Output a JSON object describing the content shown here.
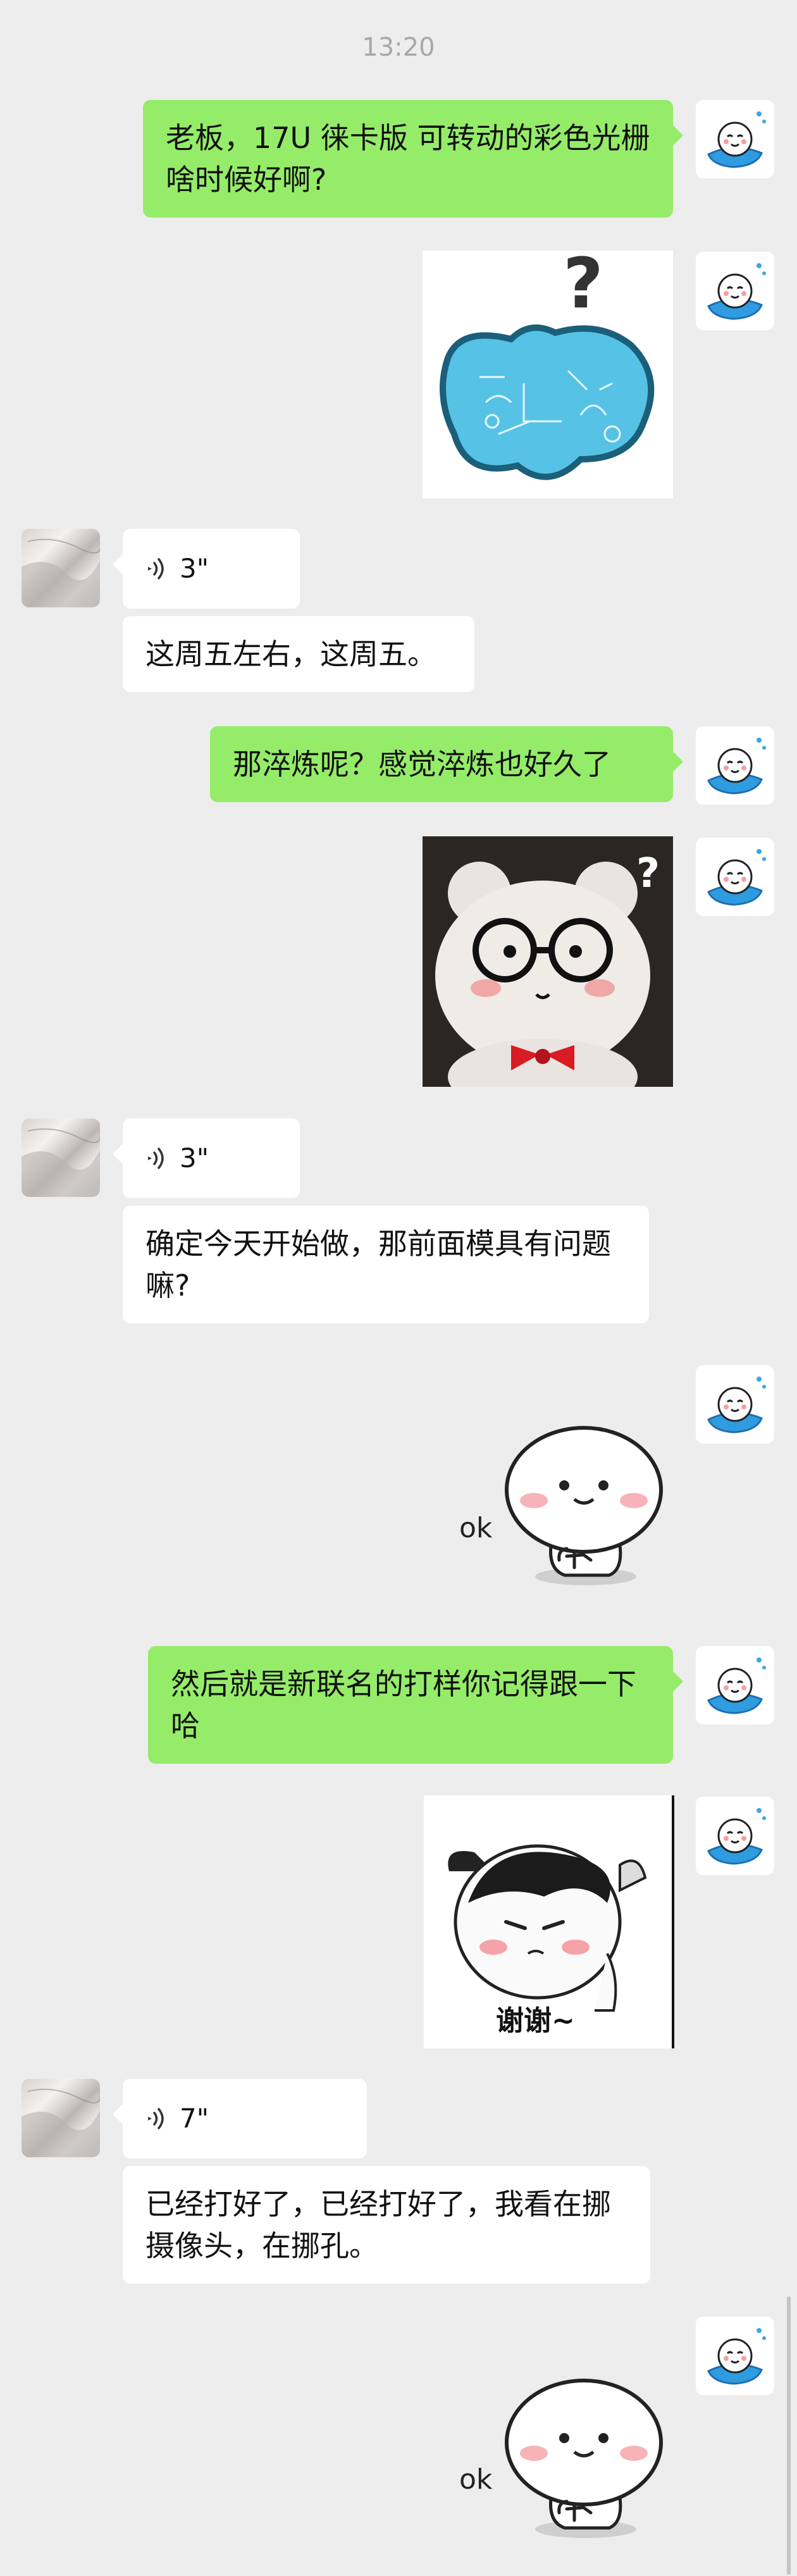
{
  "status": {
    "time": "13:20"
  },
  "messages": {
    "m1": {
      "text": "老板，17U 徕卡版 可转动的彩色光栅啥时候好啊?"
    },
    "m3": {
      "duration": "3\""
    },
    "m4": {
      "text": "这周五左右，这周五。"
    },
    "m5": {
      "text": "那淬炼呢？感觉淬炼也好久了"
    },
    "m7": {
      "duration": "3\""
    },
    "m8": {
      "text": "确定今天开始做，那前面模具有问题嘛?"
    },
    "m9": {
      "caption": "ok"
    },
    "m10": {
      "text": "然后就是新联名的打样你记得跟一下哈"
    },
    "m11": {
      "caption": "谢谢~"
    },
    "m12": {
      "duration": "7\""
    },
    "m13": {
      "text": "已经打好了，已经打好了，我看在挪摄像头，在挪孔。"
    },
    "m14": {
      "caption": "ok"
    }
  },
  "icons": {
    "self_avatar": "cartoon-on-blue-fish-avatar",
    "contact_avatar": "gray-texture-avatar",
    "voice": "voice-wave-icon"
  },
  "colors": {
    "background": "#ededed",
    "sent_bubble": "#95ec69",
    "received_bubble": "#ffffff",
    "timestamp": "#a7a7a7"
  }
}
